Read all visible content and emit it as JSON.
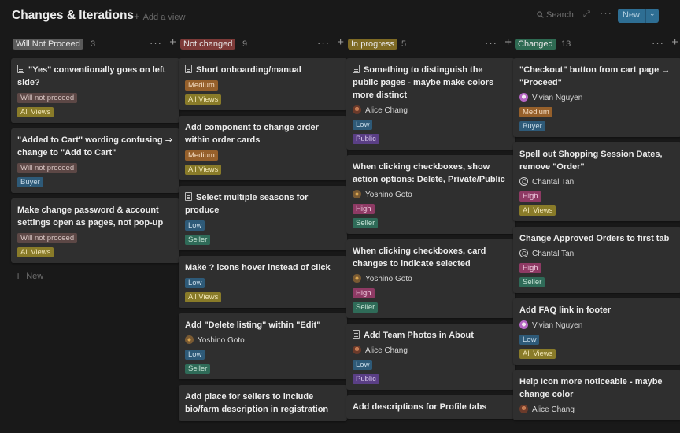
{
  "header": {
    "title": "Changes & Iterations",
    "add_view": "Add a view",
    "search": "Search",
    "new": "New"
  },
  "colors": {
    "background": "#191919",
    "card": "#2f2f2f",
    "new_button": "#2e6e93"
  },
  "columns": [
    {
      "label": "Will Not Proceed",
      "count": "3",
      "tag_color": "#5a5a5a",
      "new_label": "New",
      "cards": [
        {
          "title": "\"Yes\" conventionally goes on left side?",
          "doc": true,
          "person": "",
          "tags": [
            "Will not proceed",
            "All Views"
          ]
        },
        {
          "title": "\"Added to Cart\" wording confusing ⇒ change to \"Add to Cart\"",
          "doc": false,
          "person": "",
          "tags": [
            "Will not proceed",
            "Buyer"
          ]
        },
        {
          "title": "Make change password & account settings open as pages, not pop-up",
          "doc": false,
          "person": "",
          "tags": [
            "Will not proceed",
            "All Views"
          ]
        }
      ]
    },
    {
      "label": "Not changed",
      "count": "9",
      "tag_color": "#7d3a38",
      "cards": [
        {
          "title": "Short onboarding/manual",
          "doc": true,
          "person": "",
          "tags": [
            "Medium",
            "All Views"
          ]
        },
        {
          "title": "Add component to change order within order cards",
          "doc": false,
          "person": "",
          "tags": [
            "Medium",
            "All Views"
          ]
        },
        {
          "title": "Select multiple seasons for produce",
          "doc": true,
          "person": "",
          "tags": [
            "Low",
            "Seller"
          ]
        },
        {
          "title": "Make ? icons hover instead of click",
          "doc": false,
          "person": "",
          "tags": [
            "Low",
            "All Views"
          ]
        },
        {
          "title": "Add \"Delete listing\" within \"Edit\"",
          "doc": false,
          "person": "Yoshino Goto",
          "tags": [
            "Low",
            "Seller"
          ]
        },
        {
          "title": "Add place for sellers to include bio/farm description in registration",
          "doc": false,
          "person": "",
          "tags": []
        }
      ]
    },
    {
      "label": "In progress",
      "count": "5",
      "tag_color": "#7e6a24",
      "cards": [
        {
          "title": "Something to distinguish the public pages - maybe make colors more distinct",
          "doc": true,
          "person": "Alice Chang",
          "tags": [
            "Low",
            "Public"
          ]
        },
        {
          "title": "When clicking checkboxes, show action options: Delete, Private/Public",
          "doc": false,
          "person": "Yoshino Goto",
          "tags": [
            "High",
            "Seller"
          ]
        },
        {
          "title": "When clicking checkboxes, card changes to indicate selected",
          "doc": false,
          "person": "Yoshino Goto",
          "tags": [
            "High",
            "Seller"
          ]
        },
        {
          "title": "Add Team Photos in About",
          "doc": true,
          "person": "Alice Chang",
          "tags": [
            "Low",
            "Public"
          ]
        },
        {
          "title": "Add descriptions for Profile tabs",
          "doc": false,
          "person": "",
          "tags": []
        }
      ]
    },
    {
      "label": "Changed",
      "count": "13",
      "tag_color": "#2e6a52",
      "cards": [
        {
          "title": "\"Checkout\" button from cart page → \"Proceed\"",
          "doc": false,
          "person": "Vivian Nguyen",
          "tags": [
            "Medium",
            "Buyer"
          ]
        },
        {
          "title": "Spell out Shopping Session Dates, remove \"Order\"",
          "doc": false,
          "person": "Chantal Tan",
          "tags": [
            "High",
            "All Views"
          ]
        },
        {
          "title": "Change Approved Orders to first tab",
          "doc": false,
          "person": "Chantal Tan",
          "tags": [
            "High",
            "Seller"
          ]
        },
        {
          "title": "Add FAQ link in footer",
          "doc": false,
          "person": "Vivian Nguyen",
          "tags": [
            "Low",
            "All Views"
          ]
        },
        {
          "title": "Help Icon more noticeable - maybe change color",
          "doc": false,
          "person": "Alice Chang",
          "tags": []
        }
      ]
    }
  ]
}
